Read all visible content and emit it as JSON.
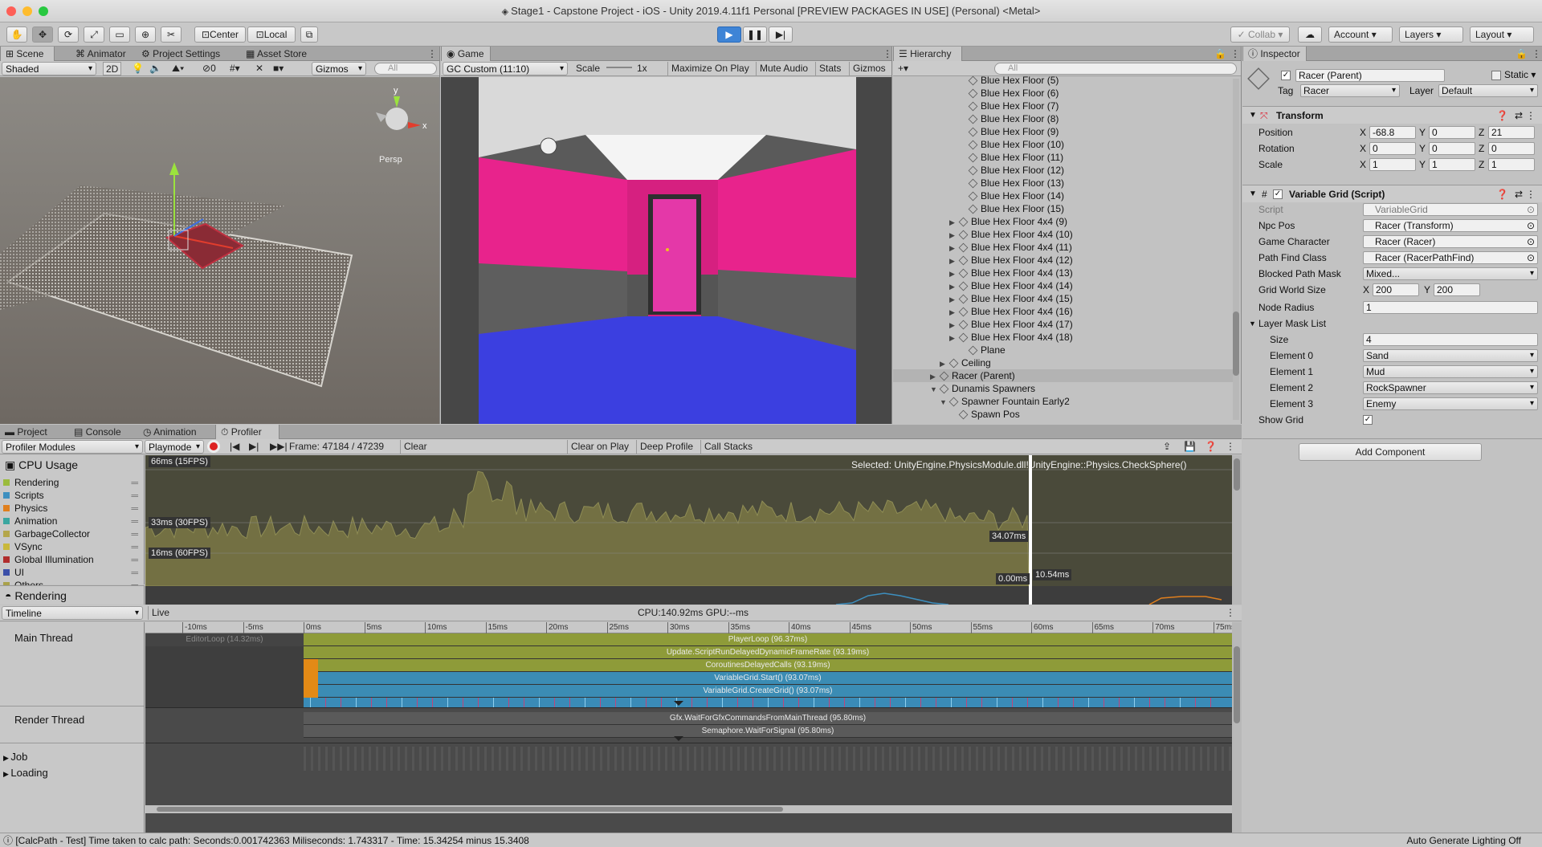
{
  "window": {
    "title": "Stage1 - Capstone Project - iOS - Unity 2019.4.11f1 Personal [PREVIEW PACKAGES IN USE] (Personal) <Metal>"
  },
  "toolbar": {
    "center": "Center",
    "local": "Local",
    "collab": "Collab",
    "account": "Account",
    "layers": "Layers",
    "layout": "Layout"
  },
  "scene": {
    "tabs": [
      "Scene",
      "Animator",
      "Project Settings",
      "Asset Store"
    ],
    "shading": "Shaded",
    "mode_2d": "2D",
    "fx_count": "0",
    "gizmos": "Gizmos",
    "search_placeholder": "All",
    "persp": "Persp"
  },
  "game": {
    "tab": "Game",
    "display": "GC Custom (11:10)",
    "scale_label": "Scale",
    "scale_value": "1x",
    "maximize": "Maximize On Play",
    "mute": "Mute Audio",
    "stats": "Stats",
    "gizmos": "Gizmos"
  },
  "hierarchy": {
    "tab": "Hierarchy",
    "search_placeholder": "All",
    "rows": [
      {
        "label": "Blue Hex Floor (5)",
        "indent": 6,
        "arrow": ""
      },
      {
        "label": "Blue Hex Floor (6)",
        "indent": 6,
        "arrow": ""
      },
      {
        "label": "Blue Hex Floor (7)",
        "indent": 6,
        "arrow": ""
      },
      {
        "label": "Blue Hex Floor (8)",
        "indent": 6,
        "arrow": ""
      },
      {
        "label": "Blue Hex Floor (9)",
        "indent": 6,
        "arrow": ""
      },
      {
        "label": "Blue Hex Floor (10)",
        "indent": 6,
        "arrow": ""
      },
      {
        "label": "Blue Hex Floor (11)",
        "indent": 6,
        "arrow": ""
      },
      {
        "label": "Blue Hex Floor (12)",
        "indent": 6,
        "arrow": ""
      },
      {
        "label": "Blue Hex Floor (13)",
        "indent": 6,
        "arrow": ""
      },
      {
        "label": "Blue Hex Floor (14)",
        "indent": 6,
        "arrow": ""
      },
      {
        "label": "Blue Hex Floor (15)",
        "indent": 6,
        "arrow": ""
      },
      {
        "label": "Blue Hex Floor 4x4 (9)",
        "indent": 5,
        "arrow": "▶"
      },
      {
        "label": "Blue Hex Floor 4x4 (10)",
        "indent": 5,
        "arrow": "▶"
      },
      {
        "label": "Blue Hex Floor 4x4 (11)",
        "indent": 5,
        "arrow": "▶"
      },
      {
        "label": "Blue Hex Floor 4x4 (12)",
        "indent": 5,
        "arrow": "▶"
      },
      {
        "label": "Blue Hex Floor 4x4 (13)",
        "indent": 5,
        "arrow": "▶"
      },
      {
        "label": "Blue Hex Floor 4x4 (14)",
        "indent": 5,
        "arrow": "▶"
      },
      {
        "label": "Blue Hex Floor 4x4 (15)",
        "indent": 5,
        "arrow": "▶"
      },
      {
        "label": "Blue Hex Floor 4x4 (16)",
        "indent": 5,
        "arrow": "▶"
      },
      {
        "label": "Blue Hex Floor 4x4 (17)",
        "indent": 5,
        "arrow": "▶"
      },
      {
        "label": "Blue Hex Floor 4x4 (18)",
        "indent": 5,
        "arrow": "▶"
      },
      {
        "label": "Plane",
        "indent": 6,
        "arrow": ""
      },
      {
        "label": "Ceiling",
        "indent": 4,
        "arrow": "▶"
      },
      {
        "label": "Racer (Parent)",
        "indent": 3,
        "arrow": "▶",
        "selected": true
      },
      {
        "label": "Dunamis Spawners",
        "indent": 3,
        "arrow": "▼"
      },
      {
        "label": "Spawner Fountain Early2",
        "indent": 4,
        "arrow": "▼"
      },
      {
        "label": "Spawn Pos",
        "indent": 5,
        "arrow": ""
      }
    ]
  },
  "inspector": {
    "tab": "Inspector",
    "object_name": "Racer (Parent)",
    "static": "Static",
    "tag_label": "Tag",
    "tag": "Racer",
    "layer_label": "Layer",
    "layer": "Default",
    "transform": {
      "title": "Transform",
      "position_label": "Position",
      "position": {
        "x": "-68.8",
        "y": "0",
        "z": "21"
      },
      "rotation_label": "Rotation",
      "rotation": {
        "x": "0",
        "y": "0",
        "z": "0"
      },
      "scale_label": "Scale",
      "scale": {
        "x": "1",
        "y": "1",
        "z": "1"
      }
    },
    "script": {
      "title": "Variable Grid (Script)",
      "fields": [
        {
          "label": "Script",
          "value": "VariableGrid",
          "kind": "obj",
          "dim": true
        },
        {
          "label": "Npc Pos",
          "value": "Racer (Transform)",
          "kind": "obj"
        },
        {
          "label": "Game Character",
          "value": "Racer (Racer)",
          "kind": "obj"
        },
        {
          "label": "Path Find Class",
          "value": "Racer (RacerPathFind)",
          "kind": "obj"
        },
        {
          "label": "Blocked Path Mask",
          "value": "Mixed...",
          "kind": "dd"
        }
      ],
      "grid_world_size_label": "Grid World Size",
      "grid_world_size": {
        "x": "200",
        "y": "200"
      },
      "node_radius_label": "Node Radius",
      "node_radius": "1",
      "layer_mask_list_label": "Layer Mask List",
      "size_label": "Size",
      "size": "4",
      "elements": [
        {
          "label": "Element 0",
          "value": "Sand"
        },
        {
          "label": "Element 1",
          "value": "Mud"
        },
        {
          "label": "Element 2",
          "value": "RockSpawner"
        },
        {
          "label": "Element 3",
          "value": "Enemy"
        }
      ],
      "show_grid_label": "Show Grid"
    },
    "add_component": "Add Component"
  },
  "bottom_tabs": [
    "Project",
    "Console",
    "Animation",
    "Profiler"
  ],
  "profiler": {
    "modules_label": "Profiler Modules",
    "playmode": "Playmode",
    "frame": "Frame: 47184 / 47239",
    "clear": "Clear",
    "clear_on_play": "Clear on Play",
    "deep_profile": "Deep Profile",
    "call_stacks": "Call Stacks",
    "cpu_usage": "CPU Usage",
    "legend": [
      {
        "name": "Rendering",
        "color": "#9bbb3c"
      },
      {
        "name": "Scripts",
        "color": "#3d8fbf"
      },
      {
        "name": "Physics",
        "color": "#e07f1d"
      },
      {
        "name": "Animation",
        "color": "#3aa6a0"
      },
      {
        "name": "GarbageCollector",
        "color": "#b4a64a"
      },
      {
        "name": "VSync",
        "color": "#c9b83a"
      },
      {
        "name": "Global Illumination",
        "color": "#b02d2d"
      },
      {
        "name": "UI",
        "color": "#3b4fa8"
      },
      {
        "name": "Others",
        "color": "#a9a14a"
      }
    ],
    "rendering_label": "Rendering",
    "gridlines": [
      "66ms (15FPS)",
      "33ms (30FPS)",
      "16ms (60FPS)"
    ],
    "selected_sample": "Selected: UnityEngine.PhysicsModule.dll!UnityEngine::Physics.CheckSphere()",
    "readouts": [
      "34.07ms",
      "10.54ms",
      "0.00ms"
    ],
    "timeline_label": "Timeline",
    "live": "Live",
    "cpu_gpu": "CPU:140.92ms   GPU:--ms",
    "ruler": [
      "-10ms",
      "-5ms",
      "0ms",
      "5ms",
      "10ms",
      "15ms",
      "20ms",
      "25ms",
      "30ms",
      "35ms",
      "40ms",
      "45ms",
      "50ms",
      "55ms",
      "60ms",
      "65ms",
      "70ms",
      "75ms"
    ],
    "threads": [
      "Main Thread",
      "Render Thread",
      "Job",
      "Loading"
    ],
    "editor_loop": "EditorLoop (14.32ms)",
    "main_samples": [
      {
        "label": "PlayerLoop (96.37ms)",
        "color": "#8e9b39"
      },
      {
        "label": "Update.ScriptRunDelayedDynamicFrameRate (93.19ms)",
        "color": "#8e9b39"
      },
      {
        "label": "CoroutinesDelayedCalls (93.19ms)",
        "color": "#8e9b39"
      },
      {
        "label": "VariableGrid.Start() (93.07ms)",
        "color": "#3b8cb4"
      },
      {
        "label": "VariableGrid.CreateGrid() (93.07ms)",
        "color": "#3b8cb4"
      }
    ],
    "render_samples": [
      {
        "label": "Gfx.WaitForGfxCommandsFromMainThread (95.80ms)"
      },
      {
        "label": "Semaphore.WaitForSignal (95.80ms)"
      }
    ]
  },
  "status": {
    "message": "[CalcPath - Test] Time taken to calc path: Seconds:0.001742363 Miliseconds: 1.743317 - Time: 15.34254 minus 15.3408",
    "right": "Auto Generate Lighting Off"
  }
}
